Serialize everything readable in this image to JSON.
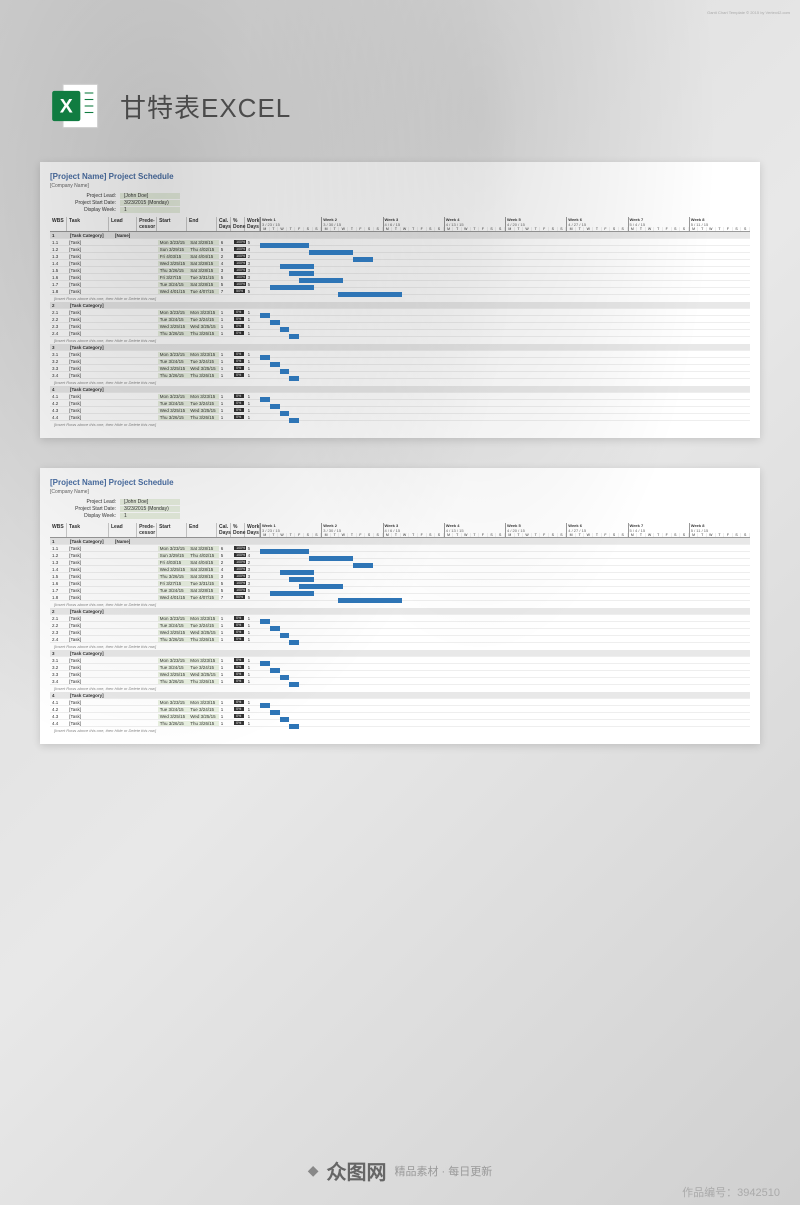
{
  "header": {
    "title": "甘特表EXCEL"
  },
  "sheet": {
    "title": "[Project Name] Project Schedule",
    "company": "[Company Name]",
    "template_note": "Gantt Chart Template © 2015 by Vertex42.com",
    "meta": {
      "lead_label": "Project Lead:",
      "lead_value": "[John Doe]",
      "start_label": "Project Start Date:",
      "start_value": "3/23/2015 (Monday)",
      "week_label": "Display Week:",
      "week_value": "1"
    },
    "columns": {
      "wbs": "WBS",
      "task": "Task",
      "lead": "Lead",
      "pred": "Prede-cessor",
      "start": "Start",
      "end": "End",
      "cal": "Cal. Days",
      "pct": "% Done",
      "work": "Work Days"
    },
    "weeks": [
      {
        "label": "Week 1",
        "date": "3 / 23 / 15"
      },
      {
        "label": "Week 2",
        "date": "3 / 30 / 15"
      },
      {
        "label": "Week 3",
        "date": "4 / 6 / 15"
      },
      {
        "label": "Week 4",
        "date": "4 / 13 / 15"
      },
      {
        "label": "Week 5",
        "date": "4 / 20 / 15"
      },
      {
        "label": "Week 6",
        "date": "4 / 27 / 15"
      },
      {
        "label": "Week 7",
        "date": "5 / 4 / 15"
      },
      {
        "label": "Week 8",
        "date": "5 / 11 / 15"
      }
    ],
    "day_letters": [
      "M",
      "T",
      "W",
      "T",
      "F",
      "S",
      "S"
    ],
    "categories": [
      {
        "wbs": "1",
        "name": "[Task Category]",
        "lead": "[Name]",
        "tasks": [
          {
            "wbs": "1.1",
            "name": "[Task]",
            "start": "Mon 3/23/15",
            "end": "Sat 3/28/15",
            "cal": "6",
            "pct": "100%",
            "work": "5",
            "bar_start": 0,
            "bar_len": 10
          },
          {
            "wbs": "1.2",
            "name": "[Task]",
            "start": "Sun 3/29/15",
            "end": "Thu 4/02/15",
            "cal": "5",
            "pct": "100%",
            "work": "4",
            "bar_start": 10,
            "bar_len": 9
          },
          {
            "wbs": "1.3",
            "name": "[Task]",
            "start": "Fri 4/03/15",
            "end": "Sat 4/04/15",
            "cal": "2",
            "pct": "100%",
            "work": "2",
            "bar_start": 19,
            "bar_len": 4
          },
          {
            "wbs": "1.4",
            "name": "[Task]",
            "start": "Wed 3/25/15",
            "end": "Sat 3/28/15",
            "cal": "4",
            "pct": "100%",
            "work": "3",
            "bar_start": 4,
            "bar_len": 7
          },
          {
            "wbs": "1.5",
            "name": "[Task]",
            "start": "Thu 3/26/15",
            "end": "Sat 3/28/15",
            "cal": "3",
            "pct": "100%",
            "work": "3",
            "bar_start": 6,
            "bar_len": 5
          },
          {
            "wbs": "1.6",
            "name": "[Task]",
            "start": "Fri 3/27/15",
            "end": "Tue 3/31/15",
            "cal": "5",
            "pct": "100%",
            "work": "3",
            "bar_start": 8,
            "bar_len": 9
          },
          {
            "wbs": "1.7",
            "name": "[Task]",
            "start": "Tue 3/24/15",
            "end": "Sat 3/28/15",
            "cal": "5",
            "pct": "100%",
            "work": "5",
            "bar_start": 2,
            "bar_len": 9
          },
          {
            "wbs": "1.8",
            "name": "[Task]",
            "start": "Wed 4/01/15",
            "end": "Tue 4/07/15",
            "cal": "7",
            "pct": "50%",
            "work": "5",
            "bar_start": 16,
            "bar_len": 13
          }
        ],
        "insert": "[Insert Rows above this one, then Hide or Delete this row]"
      },
      {
        "wbs": "2",
        "name": "[Task Category]",
        "tasks": [
          {
            "wbs": "2.1",
            "name": "[Task]",
            "start": "Mon 3/23/15",
            "end": "Mon 3/23/15",
            "cal": "1",
            "pct": "0%",
            "work": "1",
            "bar_start": 0,
            "bar_len": 2
          },
          {
            "wbs": "2.2",
            "name": "[Task]",
            "start": "Tue 3/24/15",
            "end": "Tue 3/24/15",
            "cal": "1",
            "pct": "0%",
            "work": "1",
            "bar_start": 2,
            "bar_len": 2
          },
          {
            "wbs": "2.3",
            "name": "[Task]",
            "start": "Wed 3/25/15",
            "end": "Wed 3/25/15",
            "cal": "1",
            "pct": "0%",
            "work": "1",
            "bar_start": 4,
            "bar_len": 2
          },
          {
            "wbs": "2.4",
            "name": "[Task]",
            "start": "Thu 3/26/15",
            "end": "Thu 3/26/15",
            "cal": "1",
            "pct": "0%",
            "work": "1",
            "bar_start": 6,
            "bar_len": 2
          }
        ],
        "insert": "[Insert Rows above this one, then Hide or Delete this row]"
      },
      {
        "wbs": "3",
        "name": "[Task Category]",
        "tasks": [
          {
            "wbs": "3.1",
            "name": "[Task]",
            "start": "Mon 3/23/15",
            "end": "Mon 3/23/15",
            "cal": "1",
            "pct": "0%",
            "work": "1",
            "bar_start": 0,
            "bar_len": 2
          },
          {
            "wbs": "3.2",
            "name": "[Task]",
            "start": "Tue 3/24/15",
            "end": "Tue 3/24/15",
            "cal": "1",
            "pct": "0%",
            "work": "1",
            "bar_start": 2,
            "bar_len": 2
          },
          {
            "wbs": "3.3",
            "name": "[Task]",
            "start": "Wed 3/25/15",
            "end": "Wed 3/25/15",
            "cal": "1",
            "pct": "0%",
            "work": "1",
            "bar_start": 4,
            "bar_len": 2
          },
          {
            "wbs": "3.4",
            "name": "[Task]",
            "start": "Thu 3/26/15",
            "end": "Thu 3/26/15",
            "cal": "1",
            "pct": "0%",
            "work": "1",
            "bar_start": 6,
            "bar_len": 2
          }
        ],
        "insert": "[Insert Rows above this one, then Hide or Delete this row]"
      },
      {
        "wbs": "4",
        "name": "[Task Category]",
        "tasks": [
          {
            "wbs": "4.1",
            "name": "[Task]",
            "start": "Mon 3/23/15",
            "end": "Mon 3/23/15",
            "cal": "1",
            "pct": "0%",
            "work": "1",
            "bar_start": 0,
            "bar_len": 2
          },
          {
            "wbs": "4.2",
            "name": "[Task]",
            "start": "Tue 3/24/15",
            "end": "Tue 3/24/15",
            "cal": "1",
            "pct": "0%",
            "work": "1",
            "bar_start": 2,
            "bar_len": 2
          },
          {
            "wbs": "4.3",
            "name": "[Task]",
            "start": "Wed 3/25/15",
            "end": "Wed 3/25/15",
            "cal": "1",
            "pct": "0%",
            "work": "1",
            "bar_start": 4,
            "bar_len": 2
          },
          {
            "wbs": "4.4",
            "name": "[Task]",
            "start": "Thu 3/26/15",
            "end": "Thu 3/26/15",
            "cal": "1",
            "pct": "0%",
            "work": "1",
            "bar_start": 6,
            "bar_len": 2
          }
        ],
        "insert": "[Insert Rows above this one, then Hide or Delete this row]"
      }
    ]
  },
  "watermark": {
    "brand": "众图网",
    "tagline": "精品素材 · 每日更新",
    "product_id": "作品编号：3942510"
  }
}
